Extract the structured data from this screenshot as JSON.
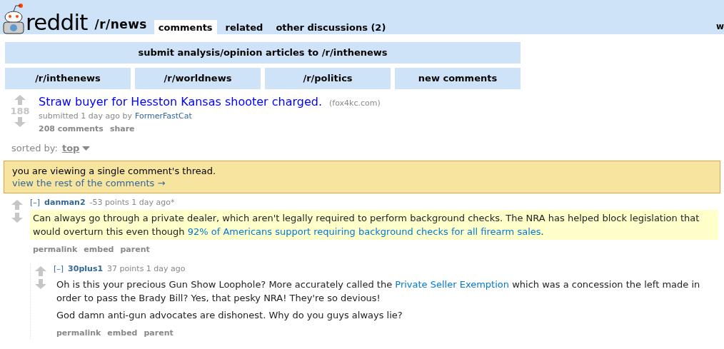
{
  "header": {
    "logo": "reddit",
    "subreddit": "/r/news",
    "tabs": [
      {
        "label": "comments",
        "selected": true
      },
      {
        "label": "related",
        "selected": false
      },
      {
        "label": "other discussions (2)",
        "selected": false
      }
    ],
    "user_cut": "w"
  },
  "submit_bar": "submit analysis/opinion articles to /r/inthenews",
  "nav_buttons": [
    "/r/inthenews",
    "/r/worldnews",
    "/r/politics",
    "new comments"
  ],
  "post": {
    "score": "188",
    "title": "Straw buyer for Hesston Kansas shooter charged.",
    "domain": "(fox4kc.com)",
    "submitted": "submitted 1 day ago by",
    "author": "FormerFastCat",
    "actions": [
      "208 comments",
      "share"
    ]
  },
  "sort": {
    "label": "sorted by:",
    "value": "top"
  },
  "notice": {
    "text": "you are viewing a single comment's thread.",
    "link": "view the rest of the comments →"
  },
  "comments": [
    {
      "toggle": "[–]",
      "author": "danman2",
      "meta": "-53 points 1 day ago*",
      "highlighted": true,
      "paragraphs": [
        [
          {
            "text": "Can always go through a private dealer, which aren't legally required to perform background checks. The NRA has helped block legislation that would overturn this even though ",
            "link": false
          },
          {
            "text": "92% of Americans support requiring background checks for all firearm sales",
            "link": true
          },
          {
            "text": ".",
            "link": false
          }
        ]
      ],
      "actions": [
        "permalink",
        "embed",
        "parent"
      ],
      "children": [
        {
          "toggle": "[–]",
          "author": "30plus1",
          "meta": "37 points 1 day ago",
          "highlighted": false,
          "paragraphs": [
            [
              {
                "text": "Oh is this your precious Gun Show Loophole? More accurately called the ",
                "link": false
              },
              {
                "text": "Private Seller Exemption",
                "link": true
              },
              {
                "text": " which was a concession the left made in order to pass the Brady Bill? Yes, that pesky NRA! They're so devious!",
                "link": false
              }
            ],
            [
              {
                "text": "God damn anti-gun advocates are dishonest. Why do you guys always lie?",
                "link": false
              }
            ]
          ],
          "actions": [
            "permalink",
            "embed",
            "parent"
          ]
        }
      ]
    }
  ]
}
